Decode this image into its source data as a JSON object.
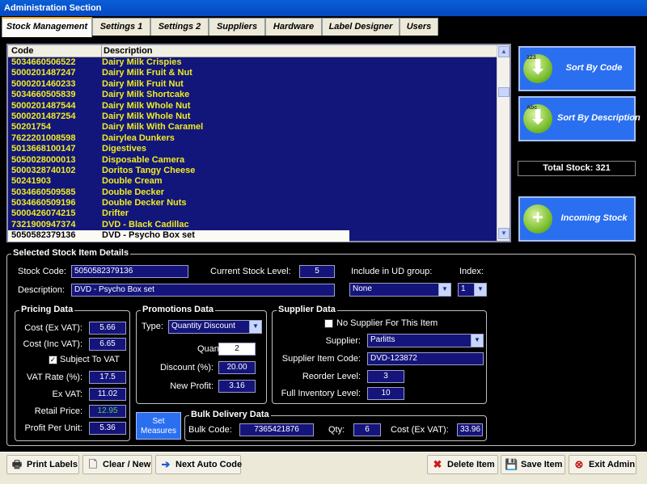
{
  "window": {
    "title": "Administration Section"
  },
  "tabs": [
    {
      "label": "Stock Management"
    },
    {
      "label": "Settings 1"
    },
    {
      "label": "Settings 2"
    },
    {
      "label": "Suppliers"
    },
    {
      "label": "Hardware"
    },
    {
      "label": "Label Designer"
    },
    {
      "label": "Users"
    }
  ],
  "list": {
    "columns": [
      "Code",
      "Description"
    ],
    "rows": [
      {
        "code": "5034660506522",
        "desc": "Dairy Milk Crispies"
      },
      {
        "code": "5000201487247",
        "desc": "Dairy Milk Fruit & Nut"
      },
      {
        "code": "5000201460233",
        "desc": "Dairy Milk Fruit Nut"
      },
      {
        "code": "5034660505839",
        "desc": "Dairy Milk Shortcake"
      },
      {
        "code": "5000201487544",
        "desc": "Dairy Milk Whole Nut"
      },
      {
        "code": "5000201487254",
        "desc": "Dairy Milk Whole Nut"
      },
      {
        "code": "50201754",
        "desc": "Dairy Milk With Caramel"
      },
      {
        "code": "7622201008598",
        "desc": "Dairylea Dunkers"
      },
      {
        "code": "5013668100147",
        "desc": "Digestives"
      },
      {
        "code": "5050028000013",
        "desc": "Disposable Camera"
      },
      {
        "code": "5000328740102",
        "desc": "Doritos Tangy Cheese"
      },
      {
        "code": "50241903",
        "desc": "Double Cream"
      },
      {
        "code": "5034660509585",
        "desc": "Double Decker"
      },
      {
        "code": "5034660509196",
        "desc": "Double Decker Nuts"
      },
      {
        "code": "5000426074215",
        "desc": "Drifter"
      },
      {
        "code": "7321900947374",
        "desc": "DVD - Black Cadillac"
      },
      {
        "code": "5050582379136",
        "desc": "DVD - Psycho Box set"
      }
    ],
    "selected_index": 16
  },
  "side": {
    "sort_code": {
      "label": "Sort By Code",
      "icon_text": "123"
    },
    "sort_desc": {
      "label": "Sort By Description",
      "icon_text": "Abc"
    },
    "total_stock": "Total Stock: 321",
    "incoming": {
      "label": "Incoming Stock"
    }
  },
  "details": {
    "title": "Selected Stock Item Details",
    "stock_code_label": "Stock Code:",
    "stock_code": "5050582379136",
    "current_level_label": "Current Stock Level:",
    "current_level": "5",
    "ud_group_label": "Include in UD group:",
    "ud_group": "None",
    "index_label": "Index:",
    "index": "1",
    "description_label": "Description:",
    "description": "DVD - Psycho Box set"
  },
  "pricing": {
    "title": "Pricing Data",
    "cost_ex_label": "Cost (Ex VAT):",
    "cost_ex": "5.66",
    "cost_inc_label": "Cost (Inc VAT):",
    "cost_inc": "6.65",
    "subject_vat_label": "Subject To VAT",
    "subject_vat": true,
    "vat_rate_label": "VAT Rate (%):",
    "vat_rate": "17.5",
    "ex_vat_label": "Ex VAT:",
    "ex_vat": "11.02",
    "retail_label": "Retail Price:",
    "retail": "12.95",
    "profit_label": "Profit Per Unit:",
    "profit": "5.36"
  },
  "promotions": {
    "title": "Promotions Data",
    "type_label": "Type:",
    "type": "Quantity Discount",
    "quantity_label": "Quantity:",
    "quantity": "2",
    "discount_label": "Discount (%):",
    "discount": "20.00",
    "new_profit_label": "New Profit:",
    "new_profit": "3.16"
  },
  "supplier": {
    "title": "Supplier Data",
    "no_supplier_label": "No Supplier For This Item",
    "no_supplier": false,
    "supplier_label": "Supplier:",
    "supplier": "Parlitts",
    "item_code_label": "Supplier Item Code:",
    "item_code": "DVD-123872",
    "reorder_label": "Reorder Level:",
    "reorder": "3",
    "full_inv_label": "Full Inventory  Level:",
    "full_inv": "10"
  },
  "set_measures": {
    "line1": "Set",
    "line2": "Measures"
  },
  "bulk": {
    "title": "Bulk Delivery Data",
    "code_label": "Bulk Code:",
    "code": "7365421876",
    "qty_label": "Qty:",
    "qty": "6",
    "cost_label": "Cost (Ex VAT):",
    "cost": "33.96"
  },
  "toolbar": {
    "print": "Print Labels",
    "clear": "Clear / New",
    "next": "Next Auto Code",
    "delete": "Delete Item",
    "save": "Save Item",
    "exit": "Exit Admin"
  },
  "colors": {
    "title_bar": "#0548c0",
    "list_bg": "#12167a",
    "list_text": "#f0ec20",
    "button_blue": "#2a6ff0",
    "icon_green": "#7cc030",
    "tab_active_accent": "#f5a623"
  }
}
